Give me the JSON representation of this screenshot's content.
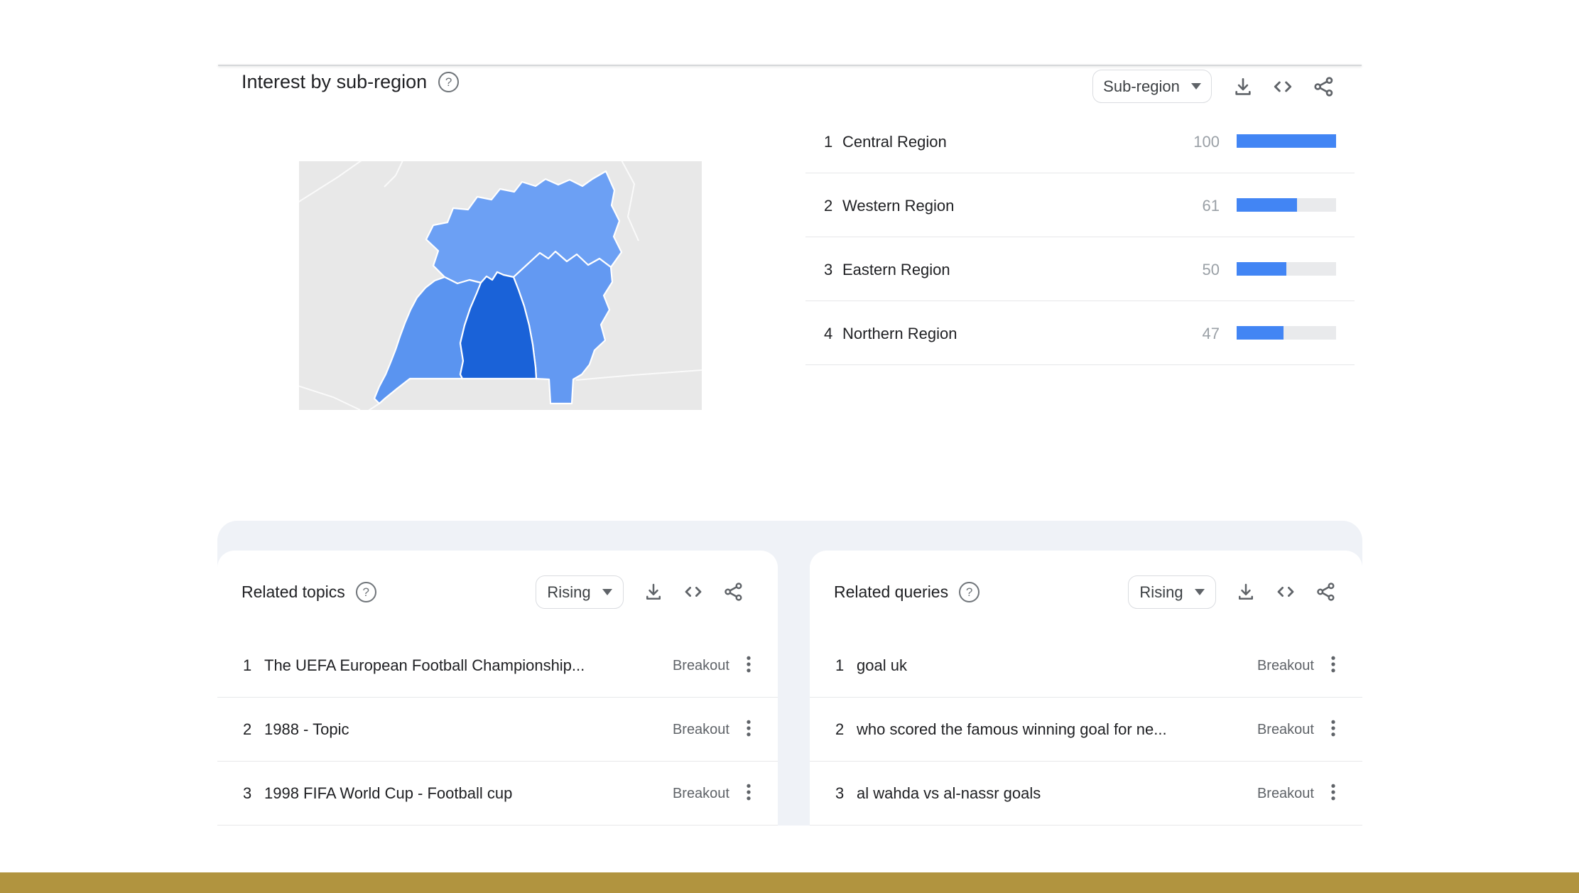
{
  "colors": {
    "accent_blue": "#4285f4",
    "bar_track": "#e9eaec",
    "panel_gray": "#eff2f7",
    "footer_gold": "#b1943f"
  },
  "interest_section": {
    "title": "Interest by sub-region",
    "help_icon": "help-circle-icon",
    "mode_dropdown": {
      "value": "Sub-region"
    },
    "toolbar_icons": [
      "download-icon",
      "embed-code-icon",
      "share-icon"
    ],
    "map": {
      "country": "Uganda",
      "colors": {
        "background": "#e8e8e8",
        "northern": "#6ca0f4",
        "eastern": "#6399f2",
        "western": "#5a94f0",
        "central": "#1a62d8"
      }
    },
    "regions": [
      {
        "rank": "1",
        "name": "Central Region",
        "value": 100
      },
      {
        "rank": "2",
        "name": "Western Region",
        "value": 61
      },
      {
        "rank": "3",
        "name": "Eastern Region",
        "value": 50
      },
      {
        "rank": "4",
        "name": "Northern Region",
        "value": 47
      }
    ]
  },
  "related_topics": {
    "title": "Related topics",
    "help_icon": "help-circle-icon",
    "sort_dropdown": {
      "value": "Rising"
    },
    "toolbar_icons": [
      "download-icon",
      "embed-code-icon",
      "share-icon"
    ],
    "items": [
      {
        "rank": "1",
        "label": "The UEFA European Football Championship...",
        "badge": "Breakout"
      },
      {
        "rank": "2",
        "label": "1988 - Topic",
        "badge": "Breakout"
      },
      {
        "rank": "3",
        "label": "1998 FIFA World Cup - Football cup",
        "badge": "Breakout"
      }
    ]
  },
  "related_queries": {
    "title": "Related queries",
    "help_icon": "help-circle-icon",
    "sort_dropdown": {
      "value": "Rising"
    },
    "toolbar_icons": [
      "download-icon",
      "embed-code-icon",
      "share-icon"
    ],
    "items": [
      {
        "rank": "1",
        "label": "goal uk",
        "badge": "Breakout"
      },
      {
        "rank": "2",
        "label": "who scored the famous winning goal for ne...",
        "badge": "Breakout"
      },
      {
        "rank": "3",
        "label": "al wahda vs al-nassr goals",
        "badge": "Breakout"
      }
    ]
  }
}
